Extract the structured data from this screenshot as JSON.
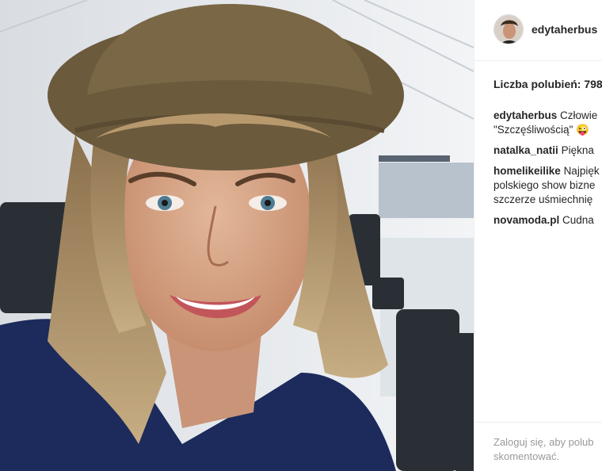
{
  "post": {
    "photo_alt": "selfie",
    "author": {
      "username": "edytaherbus"
    },
    "likes_label": "Liczba polubień: 798",
    "caption": {
      "username": "edytaherbus",
      "text_line1": "Człowie",
      "text_line2": "\"Szczęśliwością\" 😜"
    },
    "comments": [
      {
        "username": "natalka_natii",
        "text": "Piękna"
      },
      {
        "username": "homelikeilike",
        "text": "Najpięk",
        "line2": "polskiego show bizne",
        "line3": "szczerze uśmiechnię"
      },
      {
        "username": "novamoda.pl",
        "text": "Cudna"
      }
    ],
    "footer": {
      "login_link": "Zaloguj się",
      "login_rest": ", aby polub",
      "login_line2": "skomentować."
    }
  },
  "colors": {
    "text": "#262626",
    "muted": "#999999",
    "hat": "#6b5a3c",
    "shirt": "#1c2a5c",
    "background": "#e4e8ec"
  }
}
